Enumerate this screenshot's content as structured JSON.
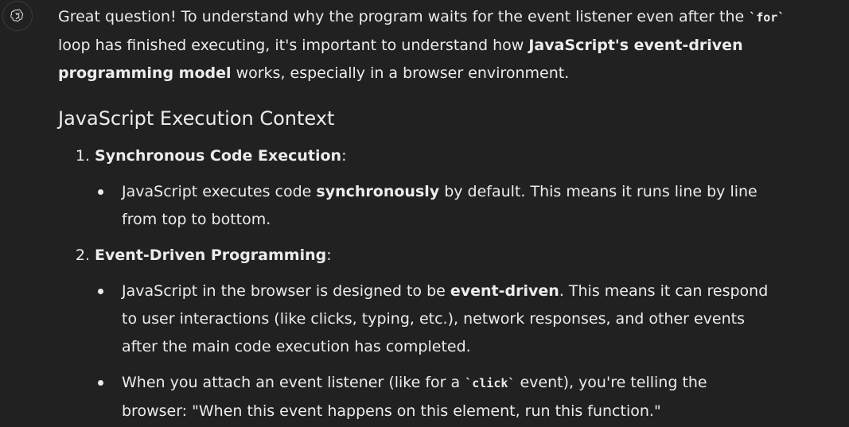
{
  "intro": {
    "part1": "Great question! To understand why the program waits for the event listener even after the ",
    "code1": "`for`",
    "part2": " loop has finished executing, it's important to understand how ",
    "bold1": "JavaScript's event-driven programming model",
    "part3": " works, especially in a browser environment."
  },
  "heading": "JavaScript Execution Context",
  "sections": [
    {
      "number": "1.",
      "title": "Synchronous Code Execution",
      "suffix": ":",
      "bullets": [
        {
          "pre": "JavaScript executes code ",
          "bold": "synchronously",
          "post": " by default. This means it runs line by line from top to bottom."
        }
      ]
    },
    {
      "number": "2.",
      "title": "Event-Driven Programming",
      "suffix": ":",
      "bullets": [
        {
          "pre": "JavaScript in the browser is designed to be ",
          "bold": "event-driven",
          "post": ". This means it can respond to user interactions (like clicks, typing, etc.), network responses, and other events after the main code execution has completed."
        },
        {
          "pre": "When you attach an event listener (like for a ",
          "code": "`click`",
          "post": " event), you're telling the browser: \"When this event happens on this element, run this function.\""
        }
      ]
    }
  ]
}
